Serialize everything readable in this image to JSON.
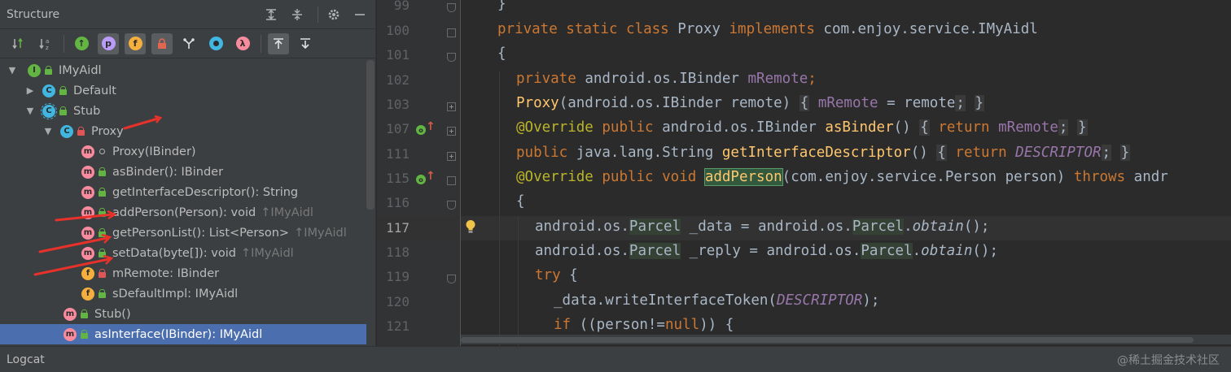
{
  "structure": {
    "title": "Structure",
    "header_icons": [
      "expand-all-icon",
      "collapse-all-icon",
      "gear-icon",
      "minimize-icon"
    ],
    "toolbar_icons": [
      "sort-by-visibility-icon",
      "sort-alphabetically-icon",
      "show-inherited-icon",
      "show-properties-icon",
      "show-fields-icon",
      "show-non-public-icon",
      "show-anonymous-icon",
      "show-lambdas-icon",
      "show-lambda-icon",
      "autoscroll-to-source-icon",
      "autoscroll-from-source-icon"
    ],
    "tree": [
      {
        "label": "IMyAidl",
        "icon": "I",
        "visibility": "public",
        "expanded": true
      },
      {
        "label": "Default",
        "icon": "C",
        "visibility": "public",
        "expanded": false
      },
      {
        "label": "Stub",
        "icon": "C",
        "visibility": "public",
        "expanded": true
      },
      {
        "label": "Proxy",
        "icon": "C",
        "visibility": "private",
        "expanded": true
      },
      {
        "label": "Proxy(IBinder)",
        "icon": "m",
        "visibility": "package"
      },
      {
        "label": "asBinder(): IBinder",
        "icon": "m",
        "visibility": "public"
      },
      {
        "label": "getInterfaceDescriptor(): String",
        "icon": "m",
        "visibility": "public"
      },
      {
        "label": "addPerson(Person): void",
        "suffix": "↑IMyAidl",
        "icon": "m",
        "visibility": "public"
      },
      {
        "label": "getPersonList(): List<Person>",
        "suffix": "↑IMyAidl",
        "icon": "m",
        "visibility": "public"
      },
      {
        "label": "setData(byte[]): void",
        "suffix": "↑IMyAidl",
        "icon": "m",
        "visibility": "public"
      },
      {
        "label": "mRemote: IBinder",
        "icon": "f",
        "visibility": "private"
      },
      {
        "label": "sDefaultImpl: IMyAidl",
        "icon": "f",
        "visibility": "public"
      },
      {
        "label": "Stub()",
        "icon": "m",
        "visibility": "public"
      },
      {
        "label": "asInterface(IBinder): IMyAidl",
        "icon": "m",
        "visibility": "public",
        "selected": true
      }
    ]
  },
  "editor": {
    "line_numbers": [
      "99",
      "100",
      "101",
      "102",
      "103",
      "107",
      "111",
      "115",
      "116",
      "117",
      "118",
      "119",
      "120",
      "121"
    ],
    "current_line": "117",
    "tokens": {
      "l99": "}",
      "l100_kw": "private static class",
      "l100_name": "Proxy",
      "l100_impl": "implements",
      "l100_type": "com.enjoy.service.IMyAidl",
      "l101": "{",
      "l102_kw": "private",
      "l102_type": "android.os.IBinder",
      "l102_field": "mRemote",
      "l102_semi": ";",
      "l103_fn": "Proxy",
      "l103_args": "(android.os.IBinder remote)",
      "l103_open": "{",
      "l103_field": "mRemote",
      "l103_rest": " = remote",
      "l103_semi": ";",
      "l103_close": "}",
      "l107_ann": "@Override",
      "l107_kw": "public",
      "l107_type": "android.os.IBinder",
      "l107_fn": "asBinder",
      "l107_parens": "()",
      "l107_open": "{",
      "l107_ret": "return",
      "l107_field": "mRemote",
      "l107_semi": ";",
      "l107_close": "}",
      "l111_kw": "public",
      "l111_type": "java.lang.String",
      "l111_fn": "getInterfaceDescriptor",
      "l111_parens": "()",
      "l111_open": "{",
      "l111_ret": "return",
      "l111_const": "DESCRIPTOR",
      "l111_semi": ";",
      "l111_close": "}",
      "l115_ann": "@Override",
      "l115_kw": "public void",
      "l115_fn": "addPerson",
      "l115_args": "(com.enjoy.service.Person person)",
      "l115_throws": "throws",
      "l115_tail": "andr",
      "l116": "{",
      "l117_a": "android.os.",
      "l117_parcel": "Parcel",
      "l117_b": " _data = android.os.",
      "l117_parcel2": "Parcel",
      "l117_dot": ".",
      "l117_fn": "obtain",
      "l117_end": "();",
      "l118_a": "android.os.",
      "l118_parcel": "Parcel",
      "l118_b": " _reply = android.os.",
      "l118_parcel2": "Parcel",
      "l118_dot": ".",
      "l118_fn": "obtain",
      "l118_end": "();",
      "l119_kw": "try",
      "l119_rest": " {",
      "l120_a": "_data.writeInterfaceToken(",
      "l120_const": "DESCRIPTOR",
      "l120_end": ");",
      "l121_kw": "if",
      "l121_a": " ((person!=",
      "l121_null": "null",
      "l121_end": ")) {"
    }
  },
  "bottom_bar": {
    "logcat": "Logcat",
    "watermark": "@稀土掘金技术社区"
  },
  "colors": {
    "keyword": "#cc7832",
    "function": "#ffc66d",
    "field": "#9876aa",
    "annotation": "#bbb529",
    "selection": "#4b6eaf",
    "arrow_annotation": "#e8312a"
  }
}
